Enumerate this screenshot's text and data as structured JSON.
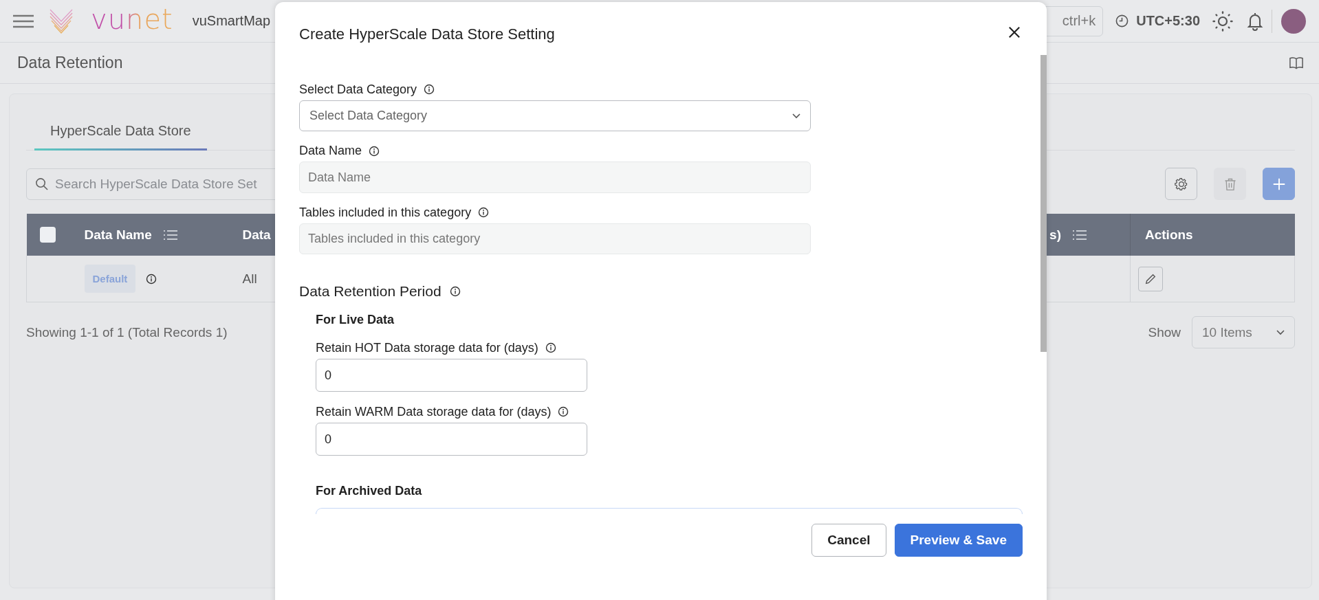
{
  "header": {
    "brand": "vunet",
    "app_name": "vuSmartMap",
    "search_shortcut": "ctrl+k",
    "timezone": "UTC+5:30"
  },
  "page": {
    "title": "Data Retention"
  },
  "tabs": [
    {
      "label": "HyperScale Data Store",
      "selected": true
    }
  ],
  "search": {
    "placeholder": "Search HyperScale Data Store Set"
  },
  "toolbar": [
    {
      "kind": "settings",
      "disabled": false
    },
    {
      "kind": "delete",
      "disabled": true
    },
    {
      "kind": "add",
      "disabled": false
    }
  ],
  "table": {
    "select_all": {
      "checked": false
    },
    "columns": [
      {
        "label": "Data Name",
        "sortable": true
      },
      {
        "label": "Data"
      },
      {
        "label": "s)",
        "sortable": true
      },
      {
        "label": "Actions",
        "sortable": false
      }
    ],
    "rows": [
      {
        "data_name": "Default",
        "column_3": "All"
      }
    ]
  },
  "pagination": {
    "summary": "Showing 1-1 of 1 (Total Records 1)",
    "show_label": "Show",
    "page_size": "10 Items"
  },
  "modal": {
    "title": "Create HyperScale Data Store Setting",
    "fields": [
      {
        "kind": "select",
        "label": "Select Data Category",
        "placeholder": "Select Data Category",
        "disabled": false
      },
      {
        "kind": "text",
        "label": "Data Name",
        "placeholder": "Data Name",
        "disabled": true
      },
      {
        "kind": "text",
        "label": "Tables included in this category",
        "placeholder": "Tables included in this category",
        "disabled": true
      }
    ],
    "retention": {
      "title": "Data Retention Period",
      "groups": [
        {
          "title": "For Live Data",
          "fields": [
            {
              "label": "Retain HOT Data storage data for (days)",
              "value": "0"
            },
            {
              "label": "Retain WARM Data storage data for (days)",
              "value": "0"
            }
          ]
        },
        {
          "title": "For Archived Data"
        }
      ]
    },
    "buttons": [
      {
        "label": "Cancel",
        "kind": "secondary"
      },
      {
        "label": "Preview & Save",
        "kind": "primary"
      }
    ]
  }
}
